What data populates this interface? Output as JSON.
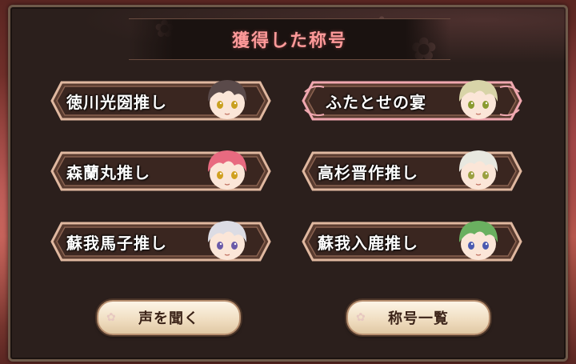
{
  "title": "獲得した称号",
  "titles": [
    {
      "label": "徳川光圀推し",
      "selected": false,
      "hair": "#5a4a4a",
      "eyes": "#c9a020"
    },
    {
      "label": "ふたとせの宴",
      "selected": true,
      "hair": "#d8d4a8",
      "eyes": "#8a9a30"
    },
    {
      "label": "森蘭丸推し",
      "selected": false,
      "hair": "#e86a80",
      "eyes": "#d0a020"
    },
    {
      "label": "高杉晋作推し",
      "selected": false,
      "hair": "#e8e8e0",
      "eyes": "#9aa040"
    },
    {
      "label": "蘇我馬子推し",
      "selected": false,
      "hair": "#dcdce4",
      "eyes": "#6a5aa8"
    },
    {
      "label": "蘇我入鹿推し",
      "selected": false,
      "hair": "#6ab060",
      "eyes": "#4a5ab0"
    }
  ],
  "buttons": {
    "listen_voice": "声を聞く",
    "title_list": "称号一覧"
  },
  "colors": {
    "title_text": "#ff9a9a",
    "plate_fill": "#3a2620",
    "plate_border": "#e0b8a0",
    "selected_border": "#f0a8b0"
  }
}
